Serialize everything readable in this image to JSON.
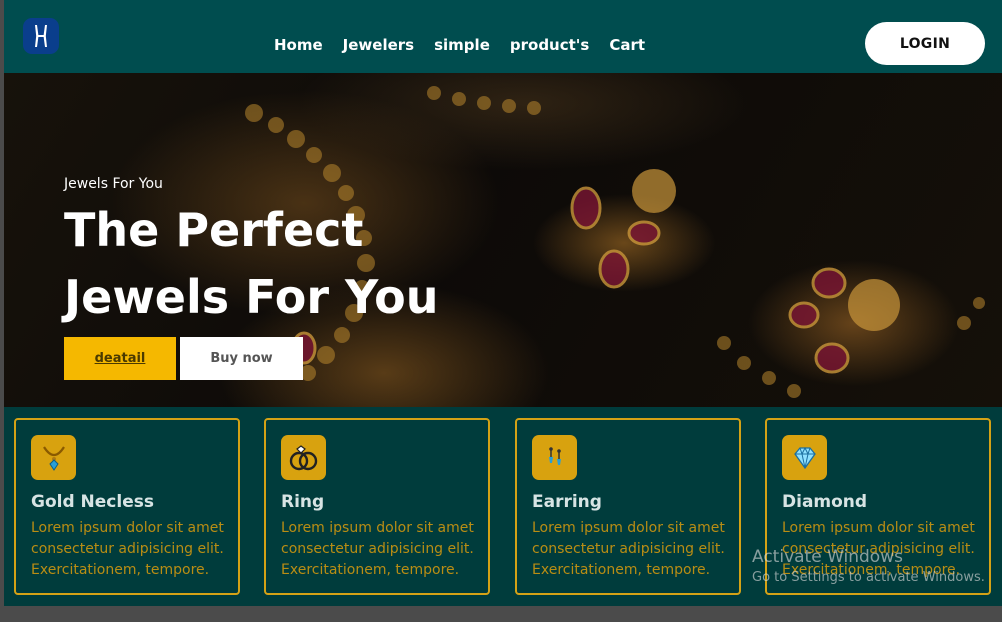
{
  "header": {
    "nav": [
      "Home",
      "Jewelers",
      "simple",
      "product's",
      "Cart"
    ],
    "login_label": "LOGIN"
  },
  "hero": {
    "subtitle": "Jewels For You",
    "title": "The Perfect Jewels For You",
    "detail_label": "deatail",
    "buy_label": "Buy now"
  },
  "cards": [
    {
      "icon": "necklace-icon",
      "title": "Gold Necless",
      "text": "Lorem ipsum dolor sit amet consectetur adipisicing elit. Exercitationem, tempore."
    },
    {
      "icon": "rings-icon",
      "title": "Ring",
      "text": "Lorem ipsum dolor sit amet consectetur adipisicing elit. Exercitationem, tempore."
    },
    {
      "icon": "earring-icon",
      "title": "Earring",
      "text": "Lorem ipsum dolor sit amet consectetur adipisicing elit. Exercitationem, tempore."
    },
    {
      "icon": "diamond-icon",
      "title": "Diamond",
      "text": "Lorem ipsum dolor sit amet consectetur adipisicing elit. Exercitationem, tempore."
    }
  ],
  "watermark": {
    "line1": "Activate Windows",
    "line2": "Go to Settings to activate Windows."
  },
  "colors": {
    "header_bg": "#004d4f",
    "body_bg": "#003c3c",
    "accent_gold": "#f5b800",
    "card_border": "#d4a216"
  }
}
